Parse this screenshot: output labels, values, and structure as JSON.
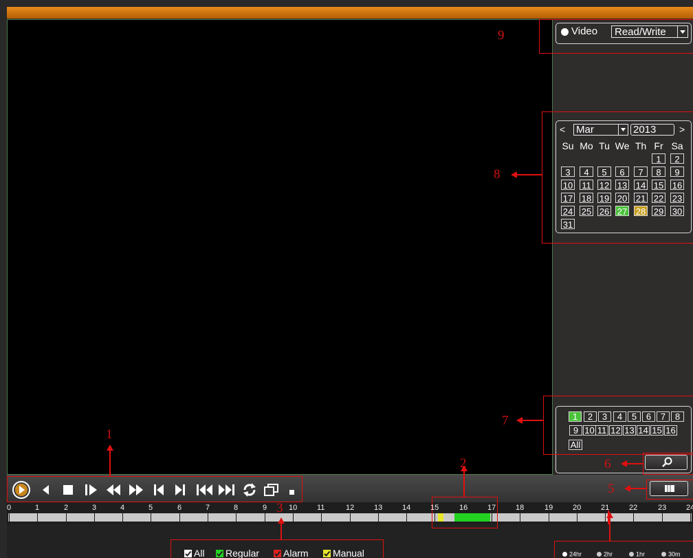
{
  "colors": {
    "title_bar": "#d97a13",
    "annotation_red": "#e01010",
    "record_regular": "#22d322",
    "record_manual": "#e6e62a",
    "record_alarm": "#e02020",
    "calendar_record_day": "#4ac23a",
    "calendar_selected_day": "#c8a020"
  },
  "annotations": [
    "1",
    "2",
    "3",
    "5",
    "6",
    "7",
    "8",
    "9"
  ],
  "mode": {
    "video_label": "Video",
    "access_value": "Read/Write"
  },
  "calendar": {
    "prev": "<",
    "next": ">",
    "month": "Mar",
    "year": "2013",
    "weekdays": [
      "Su",
      "Mo",
      "Tu",
      "We",
      "Th",
      "Fr",
      "Sa"
    ],
    "days": [
      "1",
      "2",
      "3",
      "4",
      "5",
      "6",
      "7",
      "8",
      "9",
      "10",
      "11",
      "12",
      "13",
      "14",
      "15",
      "16",
      "17",
      "18",
      "19",
      "20",
      "21",
      "22",
      "23",
      "24",
      "25",
      "26",
      "27",
      "28",
      "29",
      "30",
      "31"
    ],
    "first_weekday_index": 5,
    "record_day": "27",
    "selected_day": "28"
  },
  "channels": {
    "items": [
      "1",
      "2",
      "3",
      "4",
      "5",
      "6",
      "7",
      "8",
      "9",
      "10",
      "11",
      "12",
      "13",
      "14",
      "15",
      "16"
    ],
    "all_label": "All",
    "active_channel": "1"
  },
  "playback_controls": [
    "play-icon",
    "slow-backward-icon",
    "stop-icon",
    "frame-step-icon",
    "rewind-icon",
    "fast-forward-icon",
    "previous-frame-icon",
    "next-frame-icon",
    "previous-file-icon",
    "next-file-icon",
    "loop-icon",
    "fullscreen-icon",
    "small-stop-icon"
  ],
  "timeline": {
    "hours": [
      "0",
      "1",
      "2",
      "3",
      "4",
      "5",
      "6",
      "7",
      "8",
      "9",
      "10",
      "11",
      "12",
      "13",
      "14",
      "15",
      "16",
      "17",
      "18",
      "19",
      "20",
      "21",
      "22",
      "23",
      "24"
    ],
    "records": [
      {
        "type": "Manual",
        "start": 15.1,
        "end": 15.3
      },
      {
        "type": "Regular",
        "start": 15.7,
        "end": 16.95
      }
    ],
    "cursor": 21.1
  },
  "legend": [
    {
      "key": "all",
      "label": "All",
      "checked": true,
      "color": "#ffffff"
    },
    {
      "key": "regular",
      "label": "Regular",
      "checked": true,
      "color": "#22d322"
    },
    {
      "key": "alarm",
      "label": "Alarm",
      "checked": true,
      "color": "#e02020"
    },
    {
      "key": "manual",
      "label": "Manual",
      "checked": true,
      "color": "#e6e62a"
    }
  ],
  "zoom": {
    "options": [
      "24hr",
      "2hr",
      "1hr",
      "30m"
    ],
    "selected": "24hr"
  }
}
